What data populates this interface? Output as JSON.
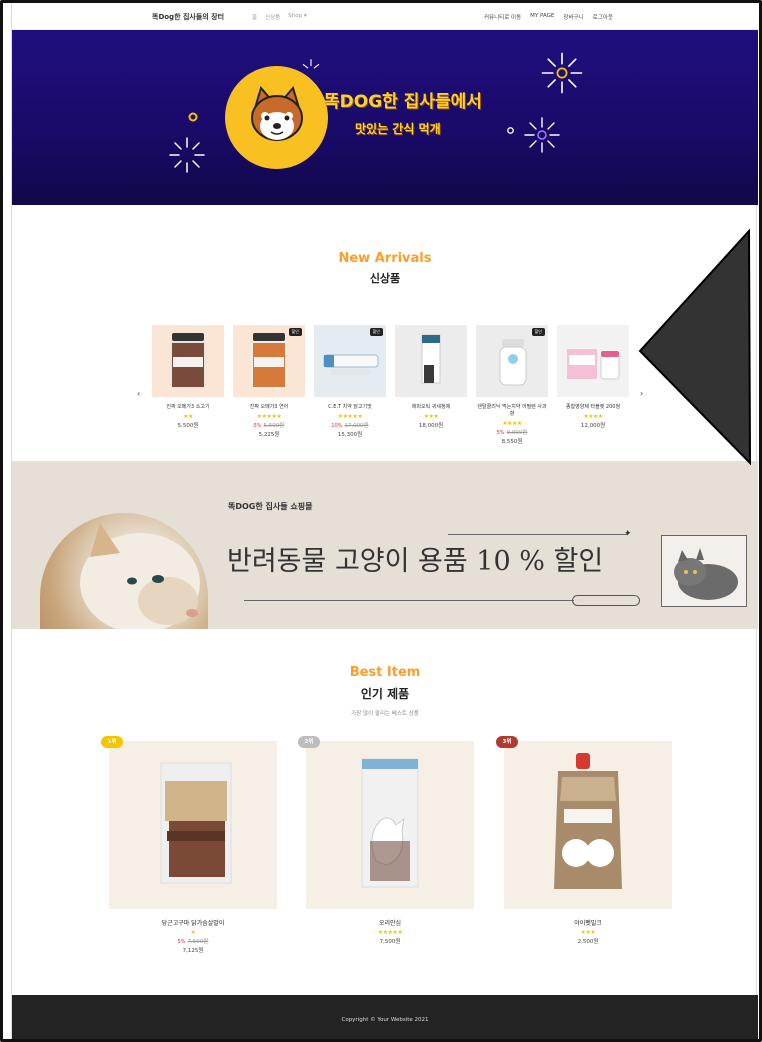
{
  "nav": {
    "brand": "똑Dog한 집사들의 장터",
    "links": [
      "홈",
      "신상품",
      "Shop"
    ],
    "right_links": [
      "커뮤니티로 이동",
      "MY PAGE",
      "장바구니",
      "로그아웃"
    ]
  },
  "hero": {
    "line1": "똑DOG한 집사들에서",
    "line2": "맛있는 간식 먹개"
  },
  "new_arrivals": {
    "title_en": "New Arrivals",
    "title_kr": "신상품",
    "products": [
      {
        "name": "진짜 오메가3 소고기",
        "stars": "★★",
        "price": "5,500원",
        "badge": "",
        "sale": "",
        "original": ""
      },
      {
        "name": "진짜 오메가3 연어",
        "stars": "★★★★★",
        "price": "5,225원",
        "badge": "할인",
        "sale": "5%",
        "original": "5,500원"
      },
      {
        "name": "C.E.T 치약 닭고기맛",
        "stars": "★★★★★",
        "price": "15,300원",
        "badge": "할인",
        "sale": "10%",
        "original": "17,000원"
      },
      {
        "name": "에피오틱 귀세정제",
        "stars": "★★★",
        "price": "18,000원",
        "badge": "",
        "sale": "",
        "original": ""
      },
      {
        "name": "덴탈클리닉 먹는치약 어필렌 사과향",
        "stars": "★★★★",
        "price": "8,550원",
        "badge": "할인",
        "sale": "5%",
        "original": "9,000원"
      },
      {
        "name": "종합영양제 타블렛 200정",
        "stars": "★★★★",
        "price": "12,000원",
        "badge": "",
        "sale": "",
        "original": ""
      }
    ],
    "prev": "‹",
    "next": "›"
  },
  "banner": {
    "small": "똑DOG한 집사들 쇼핑몰",
    "big": "반려동물 고양이 용품 10 % 할인"
  },
  "best": {
    "title_en": "Best Item",
    "title_kr": "인기 제품",
    "subtitle": "가장 많이 팔리는 베스트 상품",
    "items": [
      {
        "rank": "1위",
        "name": "당근고구마 닭가슴살말이",
        "stars": "★",
        "sale": "5%",
        "original": "7,500원",
        "price": "7,125원",
        "rank_color": "#f5c400"
      },
      {
        "rank": "2위",
        "name": "오리안심",
        "stars": "★★★★★",
        "sale": "",
        "original": "",
        "price": "7,500원",
        "rank_color": "#bdbdbd"
      },
      {
        "rank": "3위",
        "name": "아이펫밀크",
        "stars": "★★★",
        "sale": "",
        "original": "",
        "price": "2,500원",
        "rank_color": "#b03a2e"
      }
    ]
  },
  "footer": {
    "text": "Copyright © Your Website 2021"
  },
  "colors": {
    "accent": "#ff9d2b",
    "hero_bg": "#1f0f7e",
    "star": "#f5c10b",
    "footer_bg": "#232323"
  }
}
